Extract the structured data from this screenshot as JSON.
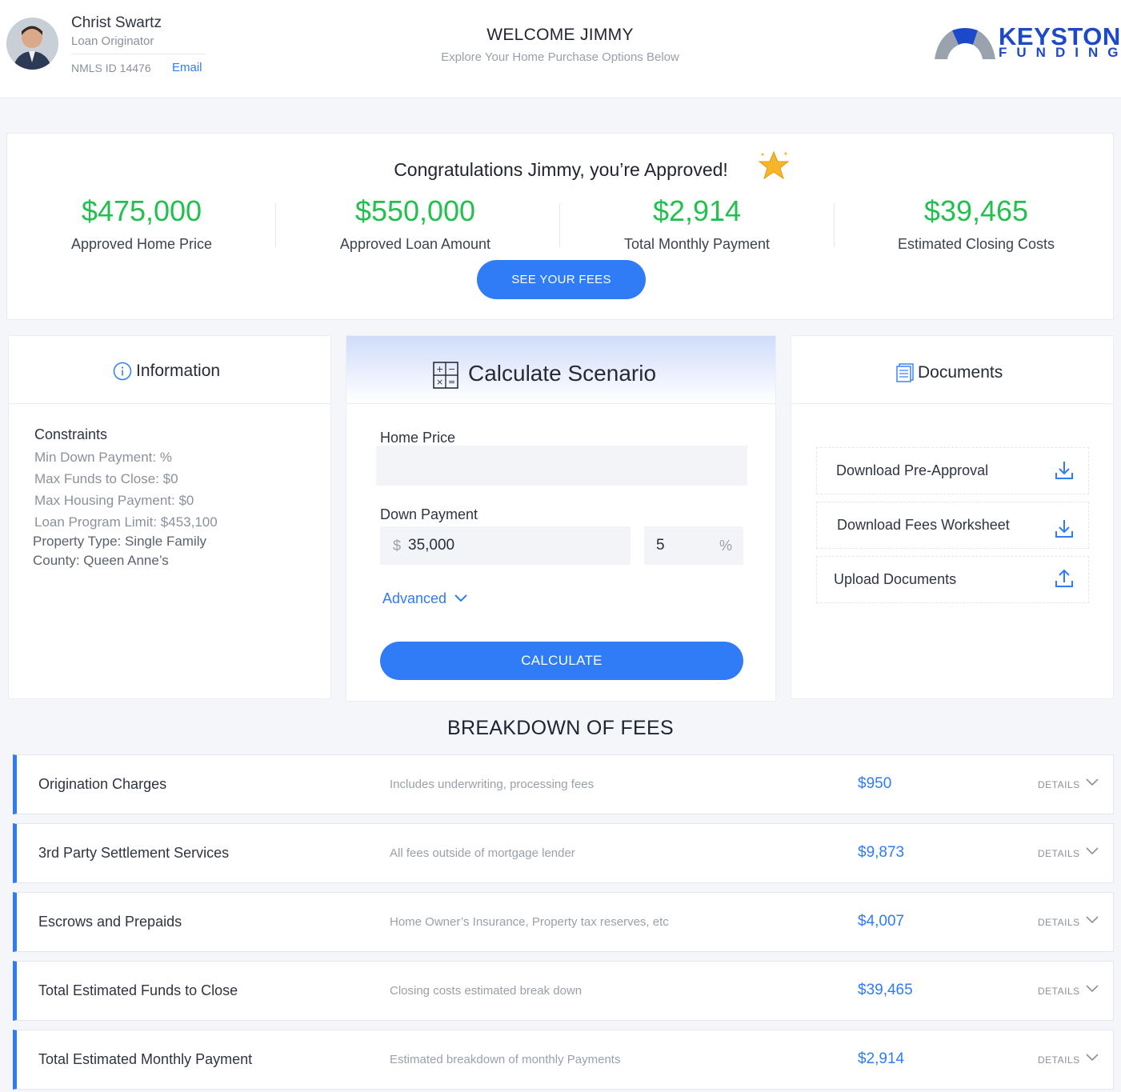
{
  "loan_officer": {
    "name": "Christ Swartz",
    "role": "Loan Originator",
    "nmls": "NMLS ID 14476",
    "email_label": "Email"
  },
  "header": {
    "welcome": "WELCOME JIMMY",
    "subtitle": "Explore Your Home Purchase Options Below"
  },
  "brand": {
    "line1": "KEYSTONE",
    "line2": "FUNDING",
    "color": "#1c49c9"
  },
  "approval": {
    "title": "Congratulations Jimmy, you’re Approved!",
    "stats": [
      {
        "value": "$475,000",
        "label": "Approved Home Price"
      },
      {
        "value": "$550,000",
        "label": "Approved Loan Amount"
      },
      {
        "value": "$2,914",
        "label": "Total Monthly Payment"
      },
      {
        "value": "$39,465",
        "label": "Estimated Closing Costs"
      }
    ],
    "button": "SEE YOUR FEES"
  },
  "information": {
    "title": "Information",
    "constraints_title": "Constraints",
    "items": [
      "Min Down Payment: %",
      "Max Funds to Close: $0",
      "Max Housing Payment: $0",
      "Loan Program Limit: $453,100",
      "Property Type: Single Family",
      "County: Queen Anne’s"
    ]
  },
  "calculator": {
    "title": "Calculate Scenario",
    "home_price_label": "Home Price",
    "home_price_value": "",
    "down_payment_label": "Down Payment",
    "currency_symbol": "$",
    "down_payment_value": "35,000",
    "down_payment_pct": "5",
    "pct_symbol": "%",
    "advanced_label": "Advanced",
    "button": "CALCULATE"
  },
  "documents": {
    "title": "Documents",
    "items": [
      {
        "label": "Download Pre-Approval",
        "icon": "download-icon"
      },
      {
        "label": "Download Fees Worksheet",
        "icon": "download-icon"
      },
      {
        "label": "Upload Documents",
        "icon": "upload-icon"
      }
    ]
  },
  "breakdown": {
    "title": "BREAKDOWN OF FEES",
    "details_label": "DETAILS",
    "rows": [
      {
        "name": "Origination Charges",
        "desc": "Includes underwriting, processing fees",
        "amount": "$950"
      },
      {
        "name": "3rd Party Settlement Services",
        "desc": "All fees outside of mortgage lender",
        "amount": "$9,873"
      },
      {
        "name": "Escrows and Prepaids",
        "desc": "Home Owner’s Insurance, Property tax reserves, etc",
        "amount": "$4,007"
      },
      {
        "name": "Total Estimated Funds to Close",
        "desc": "Closing costs estimated break down",
        "amount": "$39,465"
      },
      {
        "name": "Total Estimated Monthly Payment",
        "desc": "Estimated breakdown of monthly Payments",
        "amount": "$2,914"
      }
    ]
  },
  "colors": {
    "accent": "#2f7cf6",
    "success": "#22c04f"
  }
}
